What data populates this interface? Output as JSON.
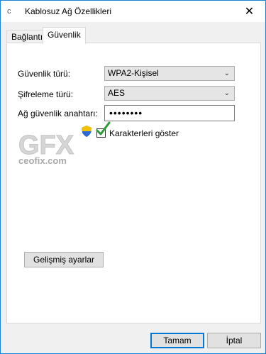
{
  "window": {
    "title": "Kablosuz Ağ Özellikleri",
    "close_glyph": "✕"
  },
  "tabs": [
    {
      "label": "Bağlantı",
      "active": false
    },
    {
      "label": "Güvenlik",
      "active": true
    }
  ],
  "security": {
    "security_type_label": "Güvenlik türü:",
    "security_type_value": "WPA2-Kişisel",
    "encryption_type_label": "Şifreleme türü:",
    "encryption_type_value": "AES",
    "network_key_label": "Ağ güvenlik anahtarı:",
    "network_key_value": "••••••••",
    "show_characters_label": "Karakterleri göster",
    "show_characters_checked": true
  },
  "watermark": {
    "site": "ceofix.com"
  },
  "advanced_button_label": "Gelişmiş ayarlar",
  "footer": {
    "ok_label": "Tamam",
    "cancel_label": "İptal"
  },
  "colors": {
    "accent": "#0078d7",
    "checkmark": "#2e9b3a"
  }
}
